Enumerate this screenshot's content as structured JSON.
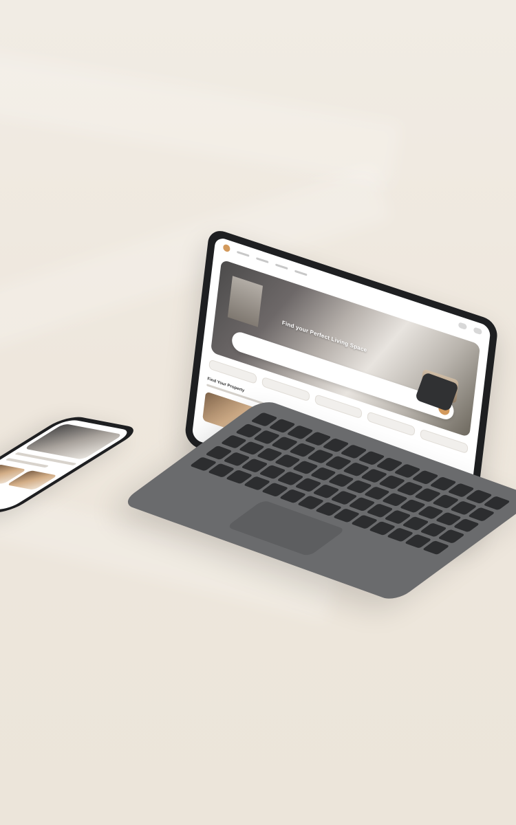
{
  "scene": {
    "background_color": "#efe9e0"
  },
  "tablet_screen": {
    "hero_title": "Find your Perfect Living Space",
    "section_title": "Find Your Property"
  }
}
